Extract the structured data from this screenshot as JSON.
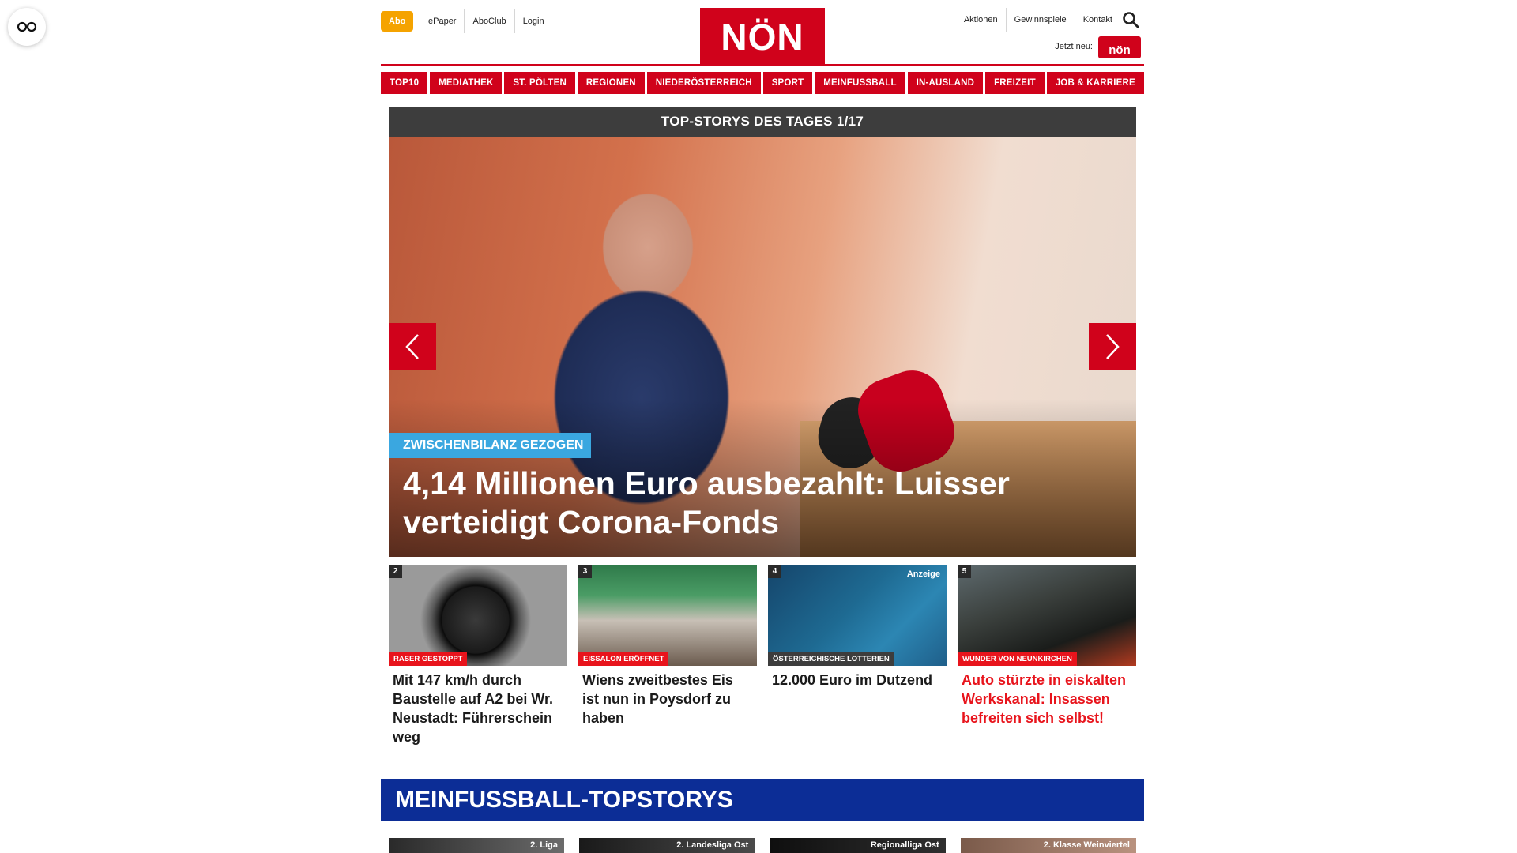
{
  "header": {
    "abo_label": "Abo",
    "left_links": [
      "ePaper",
      "AboClub",
      "Login"
    ],
    "logo_text": "NÖN",
    "right_links": [
      "Aktionen",
      "Gewinnspiele",
      "Kontakt"
    ],
    "jetzt_neu": "Jetzt neu:",
    "kinder_badge": "nön"
  },
  "nav": [
    "TOP10",
    "MEDIATHEK",
    "ST. PÖLTEN",
    "REGIONEN",
    "NIEDERÖSTERREICH",
    "SPORT",
    "MEINFUSSBALL",
    "IN-AUSLAND",
    "FREIZEIT",
    "JOB & KARRIERE"
  ],
  "hero": {
    "header": "TOP-STORYS DES TAGES 1/17",
    "kicker": "ZWISCHENBILANZ GEZOGEN",
    "title": "4,14 Millionen Euro ausbezahlt: Luisser verteidigt Corona-Fonds",
    "kicker_color": "#3aa7e0"
  },
  "teasers": [
    {
      "num": "2",
      "kicker": "RASER GESTOPPT",
      "title": "Mit 147 km/h durch Baustelle auf A2 bei Wr. Neustadt: Führerschein weg",
      "ad": "",
      "kicker_color": "#e8141c"
    },
    {
      "num": "3",
      "kicker": "EISSALON ERÖFFNET",
      "title": "Wiens zweitbestes Eis ist nun in Poysdorf zu haben",
      "ad": "",
      "kicker_color": "#e8141c"
    },
    {
      "num": "4",
      "kicker": "ÖSTERREICHISCHE LOTTERIEN",
      "title": "12.000 Euro im Dutzend",
      "ad": "Anzeige",
      "kicker_color": "#3d3d3d"
    },
    {
      "num": "5",
      "kicker": "WUNDER VON NEUNKIRCHEN",
      "title": "Auto stürzte in eiskalten Werkskanal: Insassen befreiten sich selbst!",
      "ad": "",
      "kicker_color": "#e8141c"
    }
  ],
  "meinfussball": {
    "header": "MEINFUSSBALL-TOPSTORYS",
    "cards": [
      "2. Liga",
      "2. Landesliga Ost",
      "Regionalliga Ost",
      "2. Klasse Weinviertel"
    ]
  },
  "colors": {
    "brand_red": "#d0021b",
    "fussball_blue": "#0c2d96",
    "abo_orange": "#f5a300"
  }
}
